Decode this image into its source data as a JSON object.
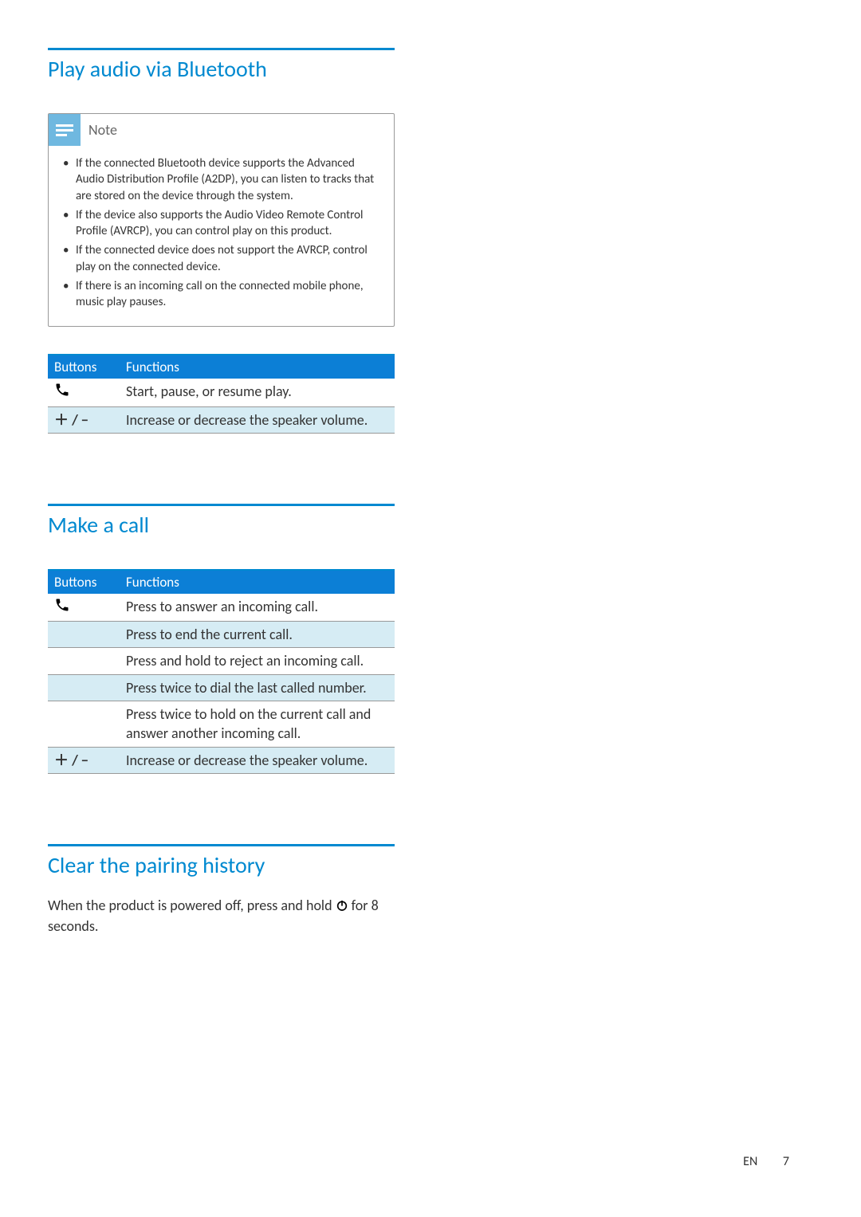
{
  "section1": {
    "title": "Play audio via Bluetooth",
    "note_label": "Note",
    "notes": [
      "If the connected Bluetooth device supports the Advanced Audio Distribution Profile (A2DP), you can listen to tracks that are stored on the device through the system.",
      "If the device also supports the Audio Video Remote Control Profile (AVRCP), you can control play on this product.",
      "If the connected device does not support the AVRCP, control play on the connected device.",
      "If there is an incoming call on the connected mobile phone, music play pauses."
    ],
    "table": {
      "head": [
        "Buttons",
        "Functions"
      ],
      "rows": [
        {
          "button_icon": "phone",
          "function": "Start, pause, or resume play.",
          "tint": false
        },
        {
          "button_icon": "plusminus",
          "function": "Increase or decrease the speaker volume.",
          "tint": true
        }
      ]
    }
  },
  "section2": {
    "title": "Make a call",
    "table": {
      "head": [
        "Buttons",
        "Functions"
      ],
      "rows": [
        {
          "button_icon": "phone",
          "function": "Press to answer an incoming call.",
          "tint": false
        },
        {
          "button_icon": "",
          "function": "Press to end the current call.",
          "tint": true
        },
        {
          "button_icon": "",
          "function": "Press and hold to reject an incoming call.",
          "tint": false
        },
        {
          "button_icon": "",
          "function": "Press twice to dial the last called number.",
          "tint": true
        },
        {
          "button_icon": "",
          "function": "Press twice to hold on the current call and answer another incoming call.",
          "tint": false
        },
        {
          "button_icon": "plusminus",
          "function": "Increase or decrease the speaker volume.",
          "tint": true
        }
      ]
    }
  },
  "section3": {
    "title": "Clear the pairing history",
    "body_before": "When the product is powered off, press and hold ",
    "body_after": " for 8 seconds."
  },
  "footer": {
    "lang": "EN",
    "page": "7"
  },
  "icons": {
    "phone": "phone-icon",
    "plusminus": "＋ / −"
  }
}
